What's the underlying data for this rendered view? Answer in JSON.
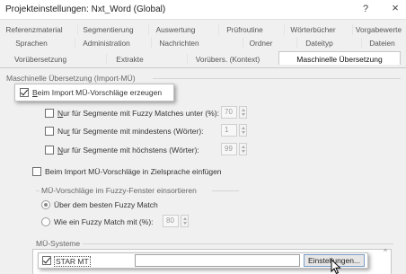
{
  "window": {
    "title": "Projekteinstellungen: Nxt_Word (Global)",
    "help_label": "?",
    "close_label": "×"
  },
  "tabs": {
    "row1": [
      "Referenzmaterial",
      "Segmentierung",
      "Auswertung",
      "Prüfroutine",
      "Wörterbücher",
      "Vorgabewerte"
    ],
    "row2": [
      "Sprachen",
      "Administration",
      "Nachrichten",
      "Ordner",
      "Dateityp",
      "Dateien"
    ],
    "row3": [
      "Vorübersetzung",
      "Extrakte",
      "Vorübers. (Kontext)",
      "Maschinelle Übersetzung"
    ],
    "active": "Maschinelle Übersetzung"
  },
  "import_section": {
    "title": "Maschinelle Übersetzung (Import-MÜ)",
    "generate_label": "Beim Import MÜ-Vorschläge erzeugen",
    "generate_accel": "B",
    "generate_rest": "eim Import MÜ-Vorschläge erzeugen",
    "generate_checked": true,
    "fuzzy_under": {
      "accel": "N",
      "rest": "ur für Segmente mit Fuzzy Matches unter (%):",
      "label": "Nur für Segmente mit Fuzzy Matches unter (%):",
      "value": "70",
      "checked": false
    },
    "min_words": {
      "pre": "Nu",
      "accel": "r",
      "rest": " für Segmente mit mindestens (Wörter):",
      "label": "Nur für Segmente mit mindestens (Wörter):",
      "value": "1",
      "checked": false
    },
    "max_words": {
      "accel": "N",
      "rest": "ur für Segmente mit höchstens (Wörter):",
      "label": "Nur für Segmente mit höchstens (Wörter):",
      "value": "99",
      "checked": false
    },
    "target_insert": {
      "label": "Beim Import MÜ-Vorschläge in Zielsprache einfügen",
      "checked": false
    }
  },
  "fuzzy_window": {
    "title": "MÜ-Vorschläge im Fuzzy-Fenster einsortieren",
    "option_best": "Über dem besten Fuzzy Match",
    "option_with": "Wie ein Fuzzy Match mit (%):",
    "option_with_value": "80",
    "selected": "option_best"
  },
  "systems": {
    "title": "MÜ-Systeme",
    "items": [
      {
        "name": "STAR MT",
        "checked": true
      }
    ],
    "settings_button_label": "Einstellungen...",
    "settings_accel": "u"
  }
}
